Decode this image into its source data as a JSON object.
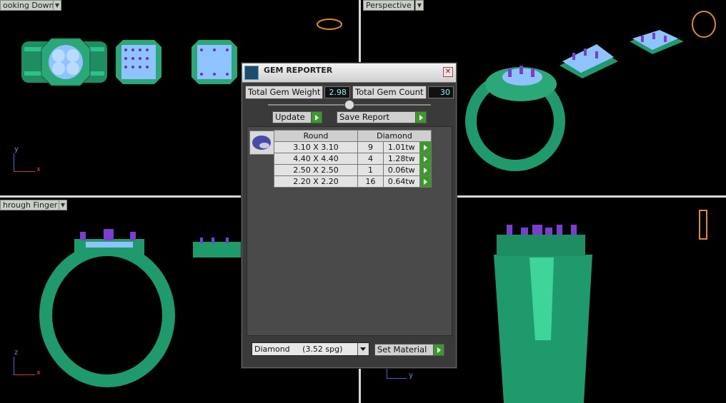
{
  "viewports": {
    "top_left": {
      "label": "ooking Down"
    },
    "top_right": {
      "label": "Perspective"
    },
    "bottom_left": {
      "label": "hrough Finger"
    },
    "bottom_right": {
      "label": ""
    }
  },
  "axes": {
    "tl_y": "y",
    "tl_x": "x",
    "bl_z": "z",
    "bl_x": "x",
    "br_y": "y"
  },
  "dialog": {
    "title": "GEM REPORTER",
    "total_gem_weight_label": "Total Gem Weight",
    "total_gem_weight_value": "2.98",
    "total_gem_count_label": "Total Gem Count",
    "total_gem_count_value": "30",
    "update_label": "Update",
    "save_report_label": "Save Report",
    "table": {
      "col_shape": "Round",
      "col_material": "Diamond",
      "rows": [
        {
          "size": "3.10 X 3.10",
          "count": "9",
          "weight": "1.01tw"
        },
        {
          "size": "4.40 X 4.40",
          "count": "4",
          "weight": "1.28tw"
        },
        {
          "size": "2.50 X 2.50",
          "count": "1",
          "weight": "0.06tw"
        },
        {
          "size": "2.20 X 2.20",
          "count": "16",
          "weight": "0.64tw"
        }
      ]
    },
    "material_select_value": "Diamond     (3.52 spg)",
    "set_material_label": "Set Material"
  },
  "colors": {
    "ring_green": "#1f9a6c",
    "gem_blue": "#7fb4ff",
    "prong_purple": "#7a3fd0",
    "accent_green": "#3a9a2a"
  }
}
